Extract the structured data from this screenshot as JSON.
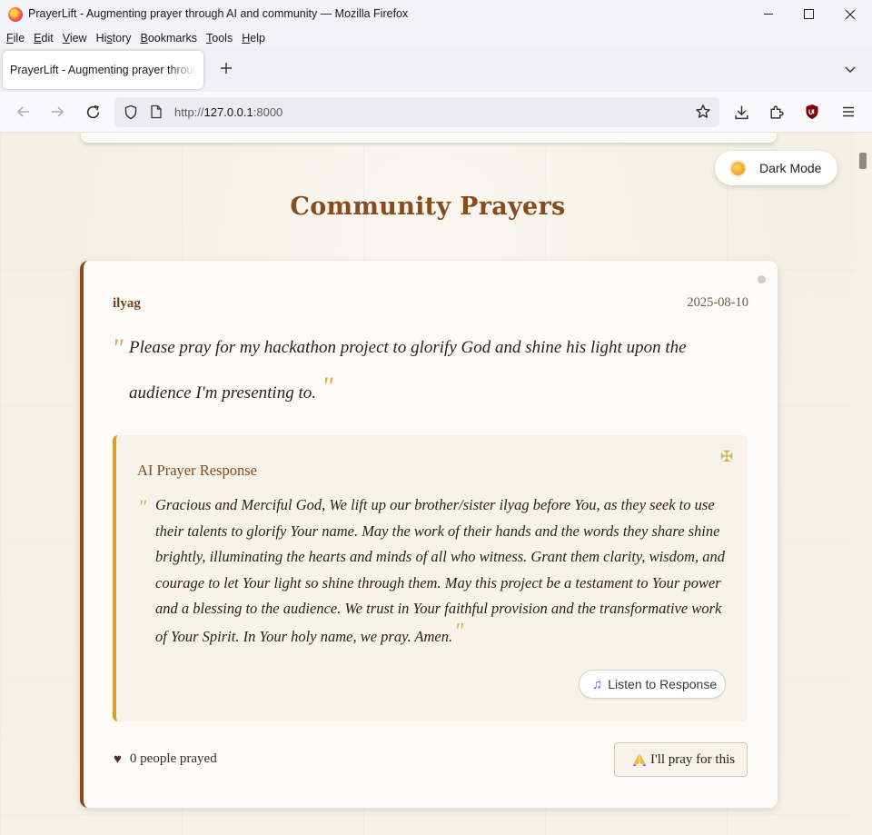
{
  "window": {
    "title": "PrayerLift - Augmenting prayer through AI and community — Mozilla Firefox"
  },
  "menu": [
    "File",
    "Edit",
    "View",
    "History",
    "Bookmarks",
    "Tools",
    "Help"
  ],
  "menu_access_keys": [
    "F",
    "E",
    "V",
    "s",
    "B",
    "T",
    "H"
  ],
  "tab": {
    "title": "PrayerLift - Augmenting prayer through AI and community"
  },
  "url": {
    "scheme": "http://",
    "host": "127.0.0.1",
    "port": ":8000"
  },
  "page": {
    "theme_toggle_label": "Dark Mode",
    "section_title": "Community Prayers",
    "prayer": {
      "author": "ilyag",
      "date": "2025-08-10",
      "text": "Please pray for my hackathon project to glorify God and shine his light upon the audience I'm presenting to.",
      "ai_response_title": "AI Prayer Response",
      "ai_response_text": "Gracious and Merciful God, We lift up our brother/sister ilyag before You, as they seek to use their talents to glorify Your name. May the work of their hands and the words they share shine brightly, illuminating the hearts and minds of all who witness. Grant them clarity, wisdom, and courage to let Your light so shine through them. May this project be a testament to Your power and a blessing to the audience. We trust in Your faithful provision and the transformative work of Your Spirit. In Your holy name, we pray. Amen.",
      "listen_label": "Listen to Response",
      "prayed_count_label": "0 people prayed",
      "pray_button_label": "I'll pray for this"
    }
  },
  "colors": {
    "accent_brown": "#8b4a16",
    "accent_gold": "#d4a12a",
    "page_background": "#f4efe4"
  }
}
